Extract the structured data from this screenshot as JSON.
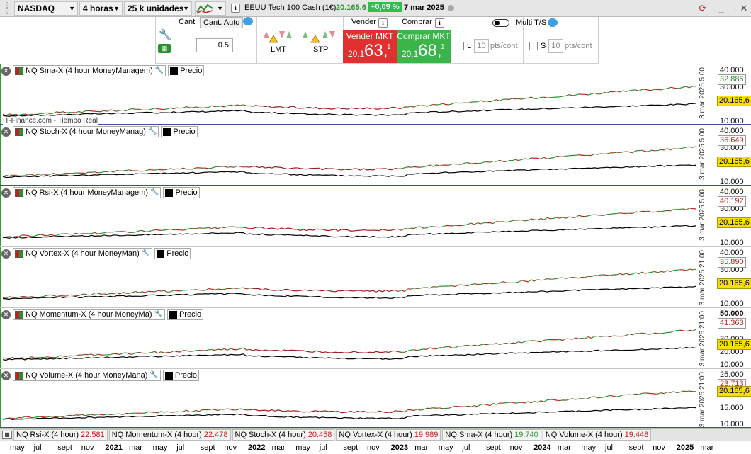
{
  "toolbar": {
    "instrument": "NASDAQ",
    "timeframe": "4 horas",
    "units": "25 k unidades",
    "product_name": "EEUU Tech 100 Cash (1€)",
    "last_price": "20.165,6",
    "change": "+0,09 %",
    "date": "7 mar 2025",
    "window_buttons": [
      "_",
      "□",
      "✕"
    ]
  },
  "ticket": {
    "qty_label": "Cant",
    "auto_qty_label": "Cant. Auto",
    "qty_value": "0.5",
    "limit_label": "LMT",
    "stop_label": "STP",
    "sell_header": "Vender",
    "buy_header": "Comprar",
    "sell_button": "Vender MKT",
    "buy_button": "Comprar MKT",
    "sell_price_small": "20.1",
    "sell_price_big": "63,",
    "sell_price_sup": "1",
    "buy_price_small": "20.1",
    "buy_price_big": "68,",
    "buy_price_sup": "1",
    "multi_ts_label": "Multi T/S",
    "limit_ts_label": "L",
    "stop_ts_label": "S",
    "limit_pts": "10",
    "stop_pts": "10",
    "pts_unit": "pts/cont"
  },
  "panels": [
    {
      "title": "NQ Sma-X (4 hour MoneyManagem)",
      "price_label": "Precio",
      "value": "32.885",
      "value_color": "#2f8f2f",
      "price": "20.165,6",
      "ticks": [
        "40.000",
        "30.000",
        "20.000",
        "10.000"
      ],
      "date_stamp": "3 mar 2025 5:00",
      "source": "IT-Finance.com - Tiempo Real"
    },
    {
      "title": "NQ Stoch-X (4 hour MoneyManag)",
      "price_label": "Precio",
      "value": "36.649",
      "value_color": "#c42020",
      "price": "20.165,6",
      "ticks": [
        "40.000",
        "30.000",
        "20.000",
        "10.000"
      ],
      "date_stamp": "3 mar 2025 5:00"
    },
    {
      "title": "NQ Rsi-X (4 hour MoneyManagem)",
      "price_label": "Precio",
      "value": "40.192",
      "value_color": "#c42020",
      "price": "20.165,6",
      "ticks": [
        "40.000",
        "30.000",
        "20.000",
        "10.000"
      ],
      "date_stamp": "3 mar 2025 5:00"
    },
    {
      "title": "NQ  Vortex-X (4 hour MoneyMan)",
      "price_label": "Precio",
      "value": "35.890",
      "value_color": "#c42020",
      "price": "20.165,6",
      "ticks": [
        "40.000",
        "30.000",
        "20.000",
        "10.000"
      ],
      "date_stamp": "3 mar 2025 21:00"
    },
    {
      "title": "NQ Momentum-X (4 hour MoneyMa)",
      "price_label": "Precio",
      "value": "41.363",
      "value_color": "#c42020",
      "price": "20.165,6",
      "ticks": [
        "50.000",
        "40.000",
        "30.000",
        "20.000",
        "10.000"
      ],
      "date_stamp": "3 mar 2025 21:00"
    },
    {
      "title": "NQ Volume-X (4 hour MoneyMana)",
      "price_label": "Precio",
      "value": "23.713",
      "value_color": "#c42020",
      "price": "20.165,6",
      "ticks": [
        "25.000",
        "20.000",
        "15.000",
        "10.000"
      ],
      "date_stamp": "3 mar 2025 21:00"
    }
  ],
  "summary": [
    {
      "label": "NQ Rsi-X (4 hour)",
      "value": "22.581",
      "color": "#c42020"
    },
    {
      "label": "NQ Momentum-X (4 hour)",
      "value": "22.478",
      "color": "#c42020"
    },
    {
      "label": "NQ Stoch-X (4 hour)",
      "value": "20.458",
      "color": "#c42020"
    },
    {
      "label": "NQ  Vortex-X (4 hour)",
      "value": "19.989",
      "color": "#c42020"
    },
    {
      "label": "NQ Sma-X (4 hour)",
      "value": "19.740",
      "color": "#2f8f2f"
    },
    {
      "label": "NQ Volume-X (4 hour)",
      "value": "19.448",
      "color": "#c42020"
    }
  ],
  "time_axis": [
    {
      "t": "may",
      "y": false
    },
    {
      "t": "jul",
      "y": false
    },
    {
      "t": "sept",
      "y": false
    },
    {
      "t": "nov",
      "y": false
    },
    {
      "t": "2021",
      "y": true
    },
    {
      "t": "mar",
      "y": false
    },
    {
      "t": "may",
      "y": false
    },
    {
      "t": "jul",
      "y": false
    },
    {
      "t": "sept",
      "y": false
    },
    {
      "t": "nov",
      "y": false
    },
    {
      "t": "2022",
      "y": true
    },
    {
      "t": "mar",
      "y": false
    },
    {
      "t": "may",
      "y": false
    },
    {
      "t": "jul",
      "y": false
    },
    {
      "t": "sept",
      "y": false
    },
    {
      "t": "nov",
      "y": false
    },
    {
      "t": "2023",
      "y": true
    },
    {
      "t": "mar",
      "y": false
    },
    {
      "t": "may",
      "y": false
    },
    {
      "t": "jul",
      "y": false
    },
    {
      "t": "sept",
      "y": false
    },
    {
      "t": "nov",
      "y": false
    },
    {
      "t": "2024",
      "y": true
    },
    {
      "t": "mar",
      "y": false
    },
    {
      "t": "may",
      "y": false
    },
    {
      "t": "jul",
      "y": false
    },
    {
      "t": "sept",
      "y": false
    },
    {
      "t": "nov",
      "y": false
    },
    {
      "t": "2025",
      "y": true
    },
    {
      "t": "mar",
      "y": false
    }
  ],
  "colors": {
    "up": "#2f8f2f",
    "down": "#c42020",
    "price": "#000000",
    "sell": "#e03030",
    "buy": "#3bb54a",
    "highlight": "#f6e000"
  }
}
